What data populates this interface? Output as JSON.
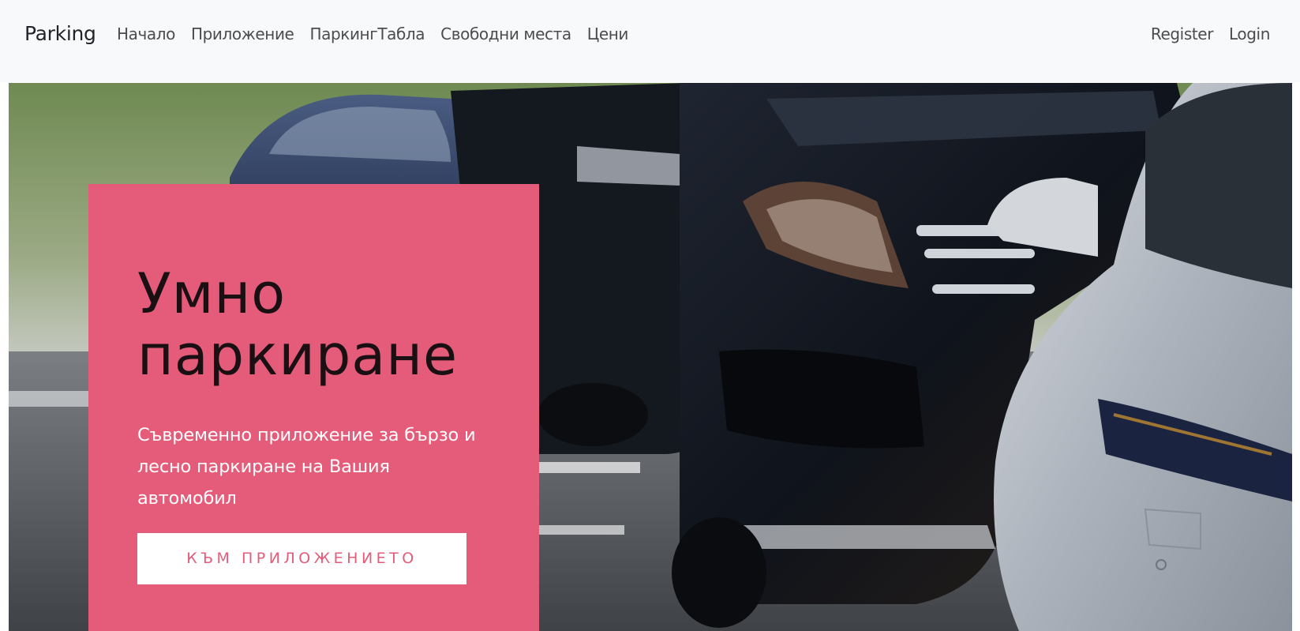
{
  "brand": {
    "label": "Parking"
  },
  "nav": {
    "left": [
      {
        "label": "Начало"
      },
      {
        "label": "Приложение"
      },
      {
        "label": "ПаркингТабла"
      },
      {
        "label": "Свободни места"
      },
      {
        "label": "Цени"
      }
    ],
    "right": [
      {
        "label": "Register"
      },
      {
        "label": "Login"
      }
    ]
  },
  "hero": {
    "title": "Умно паркиране",
    "text": "Съвременно приложение за бързо и лесно паркиране на Вашия автомобил",
    "button_label": "КЪМ ПРИЛОЖЕНИЕТО",
    "image": "parked-cars-photo"
  },
  "colors": {
    "accent": "#e45c79",
    "navbar_bg": "#f8f9fa",
    "title_text": "#1a0f12"
  }
}
